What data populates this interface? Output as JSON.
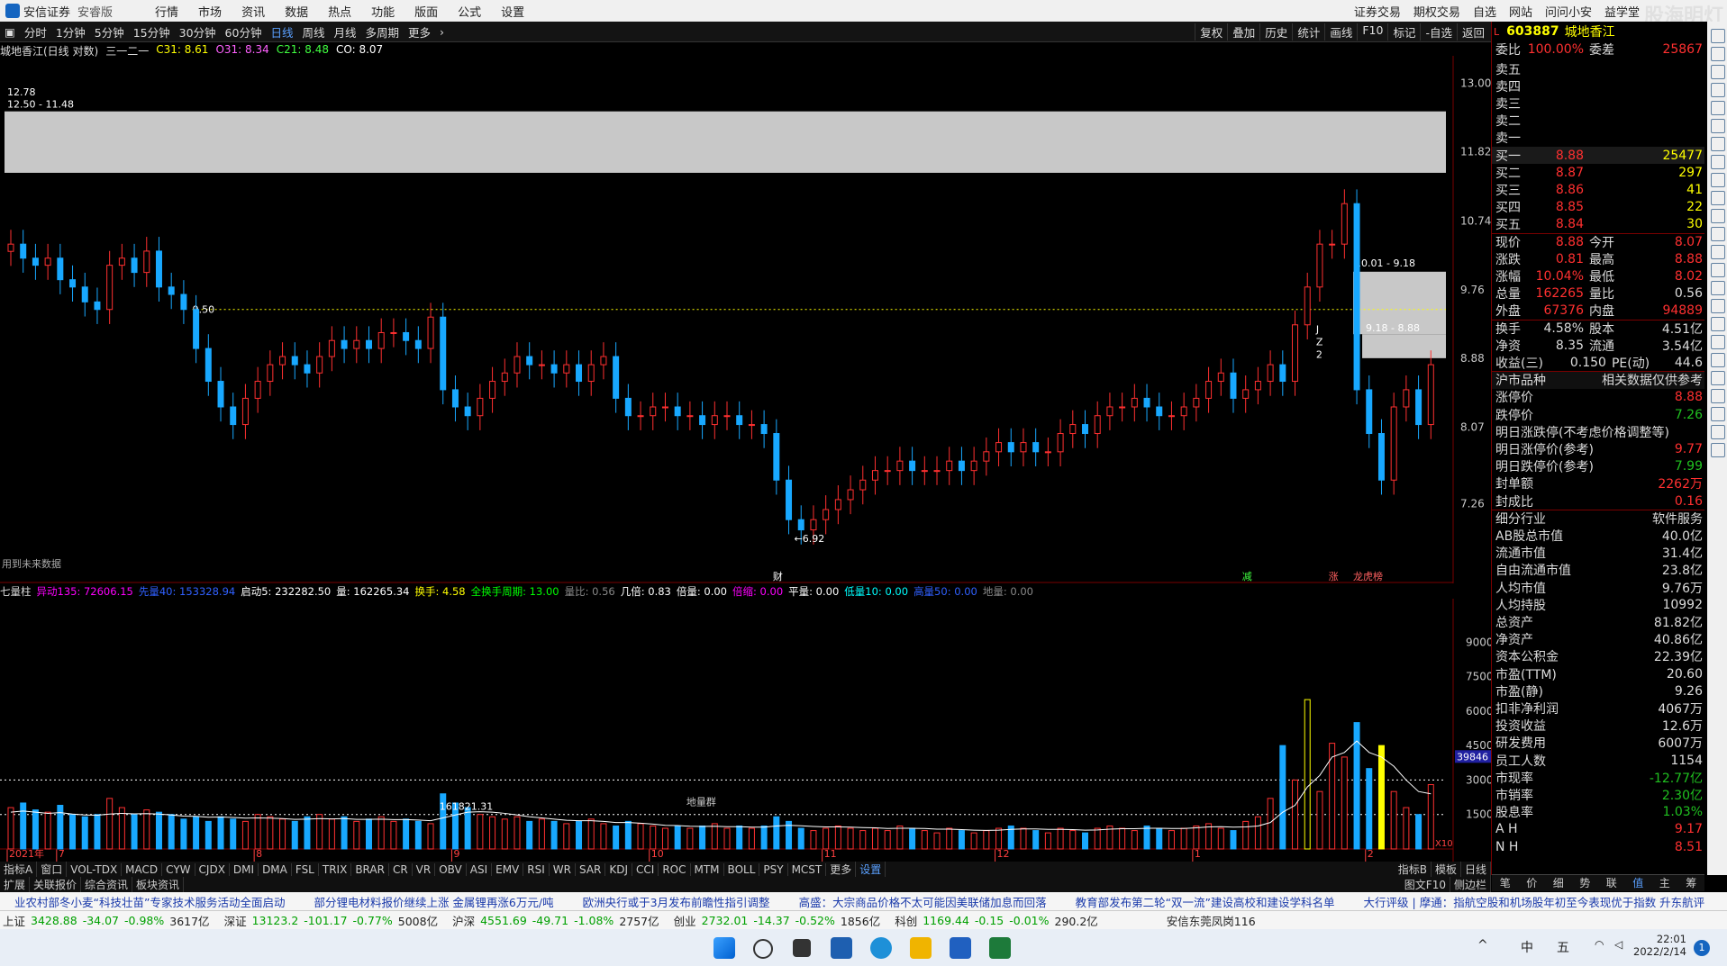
{
  "menubar": {
    "logo": "安信证券",
    "edition": "安睿版",
    "items": [
      "行情",
      "市场",
      "资讯",
      "数据",
      "热点",
      "功能",
      "版面",
      "公式",
      "设置"
    ],
    "right_items": [
      "证券交易",
      "期权交易",
      "自选",
      "网站",
      "问问小安",
      "益学堂"
    ]
  },
  "toolbar": {
    "periods": [
      "分时",
      "1分钟",
      "5分钟",
      "15分钟",
      "30分钟",
      "60分钟",
      "日线",
      "周线",
      "月线",
      "多周期",
      "更多"
    ],
    "right": [
      "复权",
      "叠加",
      "历史",
      "统计",
      "画线",
      "F10",
      "标记",
      "-自选",
      "返回"
    ]
  },
  "chart_header": {
    "stock": "城地香江(日线 对数)",
    "indicator": "三一二一",
    "c31": "C31: 8.61",
    "o31": "O31: 8.34",
    "c21": "C21: 8.48",
    "co": "CO: 8.07"
  },
  "colors": {
    "up": "#ff3030",
    "down": "#18a8ff",
    "accent": "#ffff00"
  },
  "chart_data": [
    {
      "type": "candlestick",
      "title": "城地香江(日线 对数)",
      "ylim": [
        6.5,
        13.5
      ],
      "y_ticks": [
        13.0,
        11.82,
        10.74,
        9.76,
        8.88,
        8.07,
        7.26
      ],
      "x_ticks": [
        "2021年",
        "7",
        "8",
        "9",
        "10",
        "11",
        "12",
        "1",
        "2"
      ],
      "annotations": [
        "12.50 - 11.48",
        "12.78",
        "9.50",
        "6.92",
        "10.01 - 9.18",
        "9.18 - 8.88",
        "财",
        "减",
        "涨",
        "龙虎榜",
        "用到未来数据",
        "J",
        "Z",
        "2"
      ],
      "close": [
        10.4,
        10.2,
        10.1,
        10.2,
        9.9,
        9.8,
        9.6,
        9.5,
        10.1,
        10.2,
        10.0,
        10.3,
        9.8,
        9.7,
        9.5,
        9.0,
        8.6,
        8.3,
        8.1,
        8.4,
        8.6,
        8.8,
        8.9,
        8.8,
        8.7,
        8.9,
        9.1,
        9.0,
        9.1,
        9.0,
        9.2,
        9.2,
        9.1,
        9.0,
        9.4,
        8.5,
        8.3,
        8.2,
        8.4,
        8.6,
        8.7,
        8.9,
        8.8,
        8.8,
        8.7,
        8.8,
        8.6,
        8.8,
        8.9,
        8.4,
        8.2,
        8.2,
        8.3,
        8.3,
        8.2,
        8.2,
        8.1,
        8.2,
        8.2,
        8.1,
        8.1,
        8.0,
        7.5,
        7.1,
        7.0,
        7.1,
        7.2,
        7.3,
        7.4,
        7.5,
        7.6,
        7.6,
        7.7,
        7.6,
        7.6,
        7.6,
        7.7,
        7.6,
        7.7,
        7.8,
        7.9,
        7.8,
        7.9,
        7.8,
        7.8,
        8.0,
        8.1,
        8.0,
        8.2,
        8.3,
        8.3,
        8.4,
        8.3,
        8.2,
        8.2,
        8.3,
        8.4,
        8.6,
        8.7,
        8.4,
        8.5,
        8.6,
        8.8,
        8.6,
        9.3,
        9.8,
        10.4,
        10.4,
        11.0,
        8.5,
        8.0,
        7.5,
        8.3,
        8.5,
        8.1,
        8.8
      ],
      "indicators": {
        "c31": 8.61,
        "o31": 8.34,
        "c21": 8.48,
        "co": 8.07
      }
    },
    {
      "type": "bar",
      "title": "七量柱",
      "ylim": [
        0,
        105000
      ],
      "y_ticks": [
        90000,
        75000,
        60000,
        45000,
        30000,
        15000
      ],
      "labels": [
        "161821.31",
        "39846",
        "地量群"
      ],
      "values": [
        18000,
        20000,
        17000,
        16000,
        19000,
        15000,
        14000,
        15000,
        22000,
        18000,
        15000,
        17000,
        16000,
        15000,
        13000,
        14000,
        12000,
        14000,
        13000,
        12000,
        15000,
        14000,
        13000,
        12000,
        14000,
        15000,
        13000,
        14000,
        12000,
        13000,
        14000,
        12000,
        13000,
        12000,
        11000,
        24000,
        20000,
        18000,
        15000,
        14000,
        13000,
        14000,
        12000,
        13000,
        12000,
        11000,
        12000,
        13000,
        11000,
        10000,
        12000,
        11000,
        10000,
        9000,
        10000,
        9000,
        10000,
        11000,
        9000,
        10000,
        9000,
        10000,
        14000,
        12000,
        9000,
        8000,
        9000,
        10000,
        9000,
        8000,
        9000,
        8000,
        10000,
        9000,
        8000,
        7000,
        9000,
        8000,
        7000,
        8000,
        9000,
        10000,
        9000,
        8000,
        7000,
        9000,
        8000,
        7000,
        9000,
        10000,
        9000,
        8000,
        10000,
        9000,
        8000,
        9000,
        10000,
        11000,
        9000,
        8000,
        12000,
        14000,
        22000,
        45000,
        30000,
        65000,
        25000,
        46000,
        40000,
        55000,
        35000,
        45000,
        25000,
        18000,
        15000,
        28000
      ],
      "volume_line": [
        16000,
        16500,
        16000,
        15500,
        15800,
        15200,
        14800,
        14700,
        15200,
        15500,
        15300,
        15400,
        15200,
        14800,
        14300,
        14200,
        13800,
        13900,
        13700,
        13400,
        13500,
        13400,
        13200,
        12900,
        13000,
        13200,
        13100,
        13200,
        12900,
        12900,
        13000,
        12800,
        12800,
        12600,
        12300,
        13500,
        14800,
        16000,
        16200,
        16000,
        15500,
        14800,
        14000,
        13500,
        13000,
        12500,
        12300,
        12300,
        12000,
        11500,
        11500,
        11200,
        10800,
        10300,
        10200,
        9900,
        9800,
        9900,
        9700,
        9700,
        9500,
        9500,
        10000,
        10300,
        10100,
        9800,
        9600,
        9600,
        9500,
        9300,
        9200,
        8900,
        9000,
        9000,
        8900,
        8600,
        8600,
        8400,
        8200,
        8100,
        8200,
        8500,
        8700,
        8700,
        8500,
        8500,
        8400,
        8200,
        8300,
        8600,
        8800,
        8800,
        9000,
        9000,
        8900,
        8900,
        9200,
        9600,
        9700,
        9500,
        9600,
        10000,
        11500,
        16000,
        19000,
        27000,
        32000,
        40000,
        42000,
        47000,
        42000,
        40000,
        36000,
        30000,
        25000,
        24000
      ]
    }
  ],
  "volume_header": {
    "title": "七量柱",
    "items": [
      {
        "text": "异动135: 72606.15",
        "color": "#ff00ff"
      },
      {
        "text": "先量40: 153328.94",
        "color": "#3060ff"
      },
      {
        "text": "启动5: 232282.50",
        "color": "#ffffff"
      },
      {
        "text": "量: 162265.34",
        "color": "#ffffff"
      },
      {
        "text": "换手: 4.58",
        "color": "#ffff00"
      },
      {
        "text": "全换手周期: 13.00",
        "color": "#00ff00"
      },
      {
        "text": "量比: 0.56",
        "color": "#888888"
      },
      {
        "text": "几倍: 0.83",
        "color": "#ffffff"
      },
      {
        "text": "倍量: 0.00",
        "color": "#ffffff"
      },
      {
        "text": "倍缩: 0.00",
        "color": "#ff00ff"
      },
      {
        "text": "平量: 0.00",
        "color": "#ffffff"
      },
      {
        "text": "低量10: 0.00",
        "color": "#00ffff"
      },
      {
        "text": "高量50: 0.00",
        "color": "#3060ff"
      },
      {
        "text": "地量: 0.00",
        "color": "#888888"
      }
    ]
  },
  "right_panel": {
    "code": "603887",
    "name": "城地香江",
    "rows": [
      {
        "l": "委比",
        "v": "100.00%",
        "l2": "委差",
        "v2": "25867"
      },
      {
        "l": "卖五",
        "v": ""
      },
      {
        "l": "卖四",
        "v": ""
      },
      {
        "l": "卖三",
        "v": ""
      },
      {
        "l": "卖二",
        "v": ""
      },
      {
        "l": "卖一",
        "v": ""
      },
      {
        "l": "买一",
        "v": "8.88",
        "v2": "25477"
      },
      {
        "l": "买二",
        "v": "8.87",
        "v2": "297"
      },
      {
        "l": "买三",
        "v": "8.86",
        "v2": "41"
      },
      {
        "l": "买四",
        "v": "8.85",
        "v2": "22"
      },
      {
        "l": "买五",
        "v": "8.84",
        "v2": "30"
      },
      {
        "l": "现价",
        "v": "8.88",
        "l2": "今开",
        "v2": "8.07"
      },
      {
        "l": "涨跌",
        "v": "0.81",
        "l2": "最高",
        "v2": "8.88"
      },
      {
        "l": "涨幅",
        "v": "10.04%",
        "l2": "最低",
        "v2": "8.02"
      },
      {
        "l": "总量",
        "v": "162265",
        "l2": "量比",
        "v2": "0.56"
      },
      {
        "l": "外盘",
        "v": "67376",
        "l2": "内盘",
        "v2": "94889"
      },
      {
        "l": "换手",
        "v": "4.58%",
        "l2": "股本",
        "v2": "4.51亿"
      },
      {
        "l": "净资",
        "v": "8.35",
        "l2": "流通",
        "v2": "3.54亿"
      },
      {
        "l": "收益(三)",
        "v": "0.150",
        "l2": "PE(动)",
        "v2": "44.6"
      },
      {
        "l": "沪市品种",
        "v": "相关数据仅供参考"
      },
      {
        "l": "涨停价",
        "v": "8.88"
      },
      {
        "l": "跌停价",
        "v": "7.26"
      },
      {
        "l": "明日涨跌停(不考虑价格调整等)",
        "v": ""
      },
      {
        "l": "明日涨停价(参考)",
        "v": "9.77"
      },
      {
        "l": "明日跌停价(参考)",
        "v": "7.99"
      },
      {
        "l": "封单额",
        "v": "2262万"
      },
      {
        "l": "封成比",
        "v": "0.16"
      },
      {
        "l": "细分行业",
        "v": "软件服务"
      },
      {
        "l": "AB股总市值",
        "v": "40.0亿"
      },
      {
        "l": "流通市值",
        "v": "31.4亿"
      },
      {
        "l": "自由流通市值",
        "v": "23.8亿"
      },
      {
        "l": "人均市值",
        "v": "9.76万"
      },
      {
        "l": "人均持股",
        "v": "10992"
      },
      {
        "l": "总资产",
        "v": "81.82亿"
      },
      {
        "l": "净资产",
        "v": "40.86亿"
      },
      {
        "l": "资本公积金",
        "v": "22.39亿"
      },
      {
        "l": "市盈(TTM)",
        "v": "20.60"
      },
      {
        "l": "市盈(静)",
        "v": "9.26"
      },
      {
        "l": "扣非净利润",
        "v": "4067万"
      },
      {
        "l": "投资收益",
        "v": "12.6万"
      },
      {
        "l": "研发费用",
        "v": "6007万"
      },
      {
        "l": "员工人数",
        "v": "1154"
      },
      {
        "l": "市现率",
        "v": "-12.77亿"
      },
      {
        "l": "市销率",
        "v": "2.30亿"
      },
      {
        "l": "股息率",
        "v": "1.03%"
      },
      {
        "l": "A H",
        "v": "9.17"
      },
      {
        "l": "N H",
        "v": "8.51"
      }
    ],
    "tabs": [
      "笔",
      "价",
      "细",
      "势",
      "联",
      "值",
      "主",
      "筹"
    ]
  },
  "bottom_bar1": [
    "指标A",
    "窗口",
    "VOL-TDX",
    "MACD",
    "CYW",
    "CJDX",
    "DMI",
    "DMA",
    "FSL",
    "TRIX",
    "BRAR",
    "CR",
    "VR",
    "OBV",
    "ASI",
    "EMV",
    "RSI",
    "WR",
    "SAR",
    "KDJ",
    "CCI",
    "ROC",
    "MTM",
    "BOLL",
    "PSY",
    "MCST",
    "更多",
    "设置",
    "指标B",
    "模板"
  ],
  "bottom_bar2": [
    "扩展",
    "关联报价",
    "综合资讯",
    "板块资讯",
    "图文F10",
    "侧边栏"
  ],
  "news": [
    "业农村部冬小麦“科技壮苗”专家技术服务活动全面启动",
    "部分锂电材料报价继续上涨 金属锂再涨6万元/吨",
    "欧洲央行或于3月发布前瞻性指引调整",
    "高盛：大宗商品价格不太可能因美联储加息而回落",
    "教育部发布第二轮“双一流”建设高校和建设学科名单",
    "大行评级 | 摩通：指航空股和机场股年初至今表现优于指数 升东航评"
  ],
  "indices": [
    {
      "name": "上证",
      "v": "3428.88",
      "c": "-34.07",
      "p": "-0.98%",
      "a": "3617亿"
    },
    {
      "name": "深证",
      "v": "13123.2",
      "c": "-101.17",
      "p": "-0.77%",
      "a": "5008亿"
    },
    {
      "name": "沪深",
      "v": "4551.69",
      "c": "-49.71",
      "p": "-1.08%",
      "a": "2757亿"
    },
    {
      "name": "创业",
      "v": "2732.01",
      "c": "-14.37",
      "p": "-0.52%",
      "a": "1856亿"
    },
    {
      "name": "科创",
      "v": "1169.44",
      "c": "-0.15",
      "p": "-0.01%",
      "a": "290.2亿"
    }
  ],
  "branch": "安信东莞凤岗116",
  "taskbar": {
    "time": "22:01",
    "date": "2022/2/14",
    "ime1": "中",
    "ime2": "五"
  },
  "corner_labels": {
    "watermark": "股海明灯",
    "vol_marker": "X10",
    "day": "日线"
  }
}
